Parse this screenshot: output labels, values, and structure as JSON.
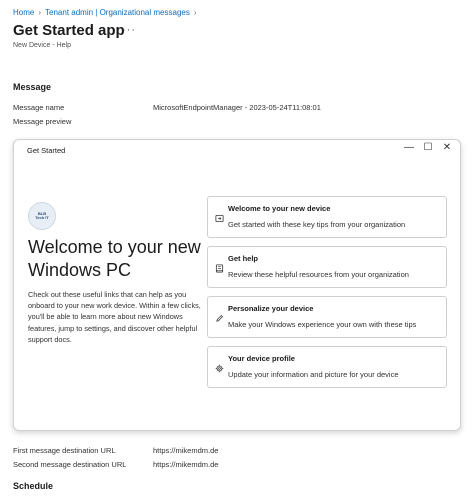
{
  "breadcrumb": {
    "items": [
      "Home",
      "Tenant admin | Organizational messages"
    ]
  },
  "page": {
    "title": "Get Started app",
    "more": "···",
    "subtitle": "New Device - Help"
  },
  "message_section": {
    "heading": "Message",
    "rows": [
      {
        "label": "Message name",
        "value": "MicrosoftEndpointManager - 2023-05-24T11:08:01"
      },
      {
        "label": "Message preview",
        "value": ""
      }
    ]
  },
  "preview_window": {
    "title": "Get Started",
    "controls": {
      "minimize": "—",
      "maximize": "☐",
      "close": "✕"
    },
    "logo_text": [
      "Tech IT",
      "BLB"
    ],
    "heading": "Welcome to your new Windows PC",
    "body": "Check out these useful links that can help as you onboard to your new work device. Within a few clicks, you'll be able to learn more about new Windows features, jump to settings, and discover other helpful support docs.",
    "cards": [
      {
        "icon": "new-device-icon",
        "title": "Welcome to your new device",
        "desc": "Get started with these key tips from your organization"
      },
      {
        "icon": "help-book-icon",
        "title": "Get help",
        "desc": "Review these helpful resources from your organization"
      },
      {
        "icon": "pencil-icon",
        "title": "Personalize your device",
        "desc": "Make your Windows experience your own with these tips"
      },
      {
        "icon": "gear-icon",
        "title": "Your device profile",
        "desc": "Update your information and picture for your device"
      }
    ]
  },
  "destinations": [
    {
      "label": "First message destination URL",
      "value": "https://mikemdm.de"
    },
    {
      "label": "Second message destination URL",
      "value": "https://mikemdm.de"
    }
  ],
  "schedule_section": {
    "heading": "Schedule"
  }
}
